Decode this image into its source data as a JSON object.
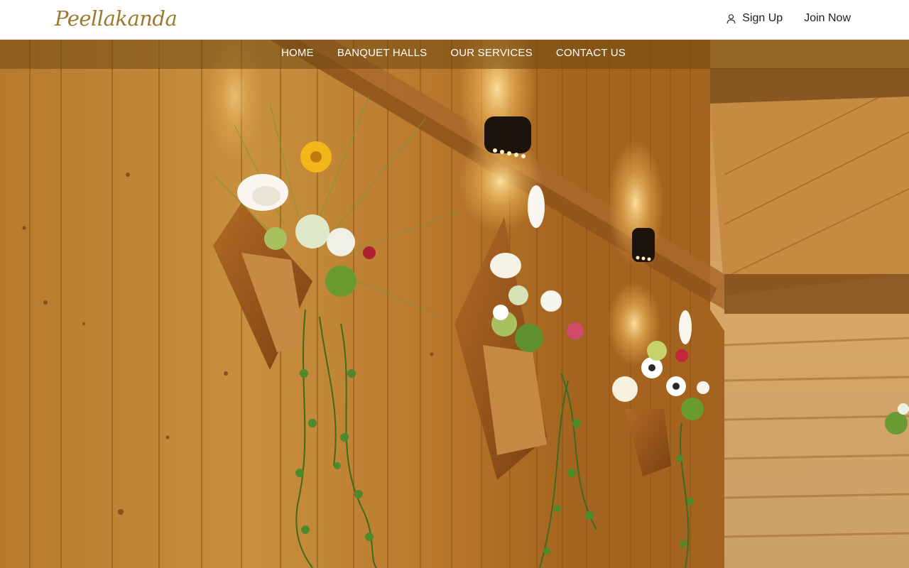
{
  "brand": {
    "name": "Peellakanda"
  },
  "header": {
    "signup_label": "Sign Up",
    "signup_icon": "user-icon",
    "join_label": "Join Now"
  },
  "nav": {
    "items": [
      {
        "label": "HOME"
      },
      {
        "label": "BANQUET HALLS"
      },
      {
        "label": "OUR SERVICES"
      },
      {
        "label": "CONTACT US"
      }
    ]
  },
  "colors": {
    "brand_gold": "#9c7a2c",
    "nav_overlay": "#6e4812",
    "wood": "#c08a3e"
  }
}
